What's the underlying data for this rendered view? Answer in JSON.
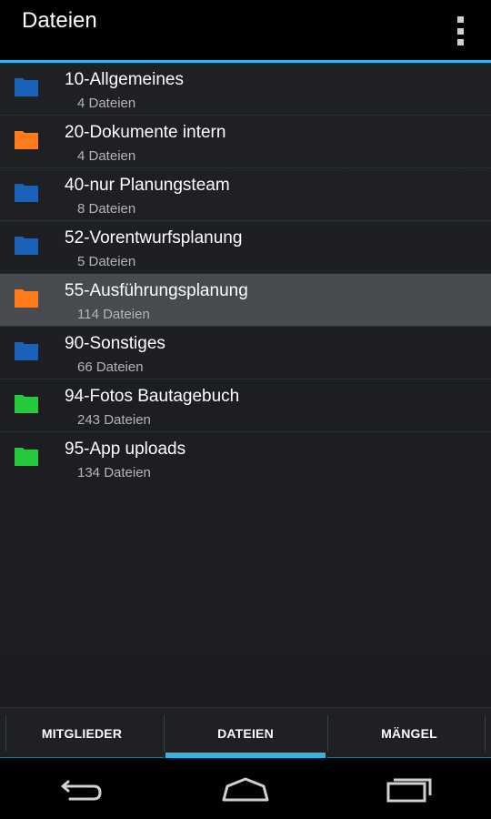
{
  "actionbar": {
    "title": "Dateien",
    "menu_icon": "overflow-menu-icon"
  },
  "colors": {
    "accent": "#33b5e5",
    "folder_blue": "#1a62b8",
    "folder_orange": "#ff7a1a",
    "folder_green": "#25c93c"
  },
  "folders": [
    {
      "name": "10-Allgemeines",
      "count": "4 Dateien",
      "color": "blue",
      "selected": false
    },
    {
      "name": "20-Dokumente intern",
      "count": "4 Dateien",
      "color": "orange",
      "selected": false
    },
    {
      "name": "40-nur Planungsteam",
      "count": "8 Dateien",
      "color": "blue",
      "selected": false
    },
    {
      "name": "52-Vorentwurfsplanung",
      "count": "5 Dateien",
      "color": "blue",
      "selected": false
    },
    {
      "name": "55-Ausführungsplanung",
      "count": "114 Dateien",
      "color": "orange",
      "selected": true
    },
    {
      "name": "90-Sonstiges",
      "count": "66 Dateien",
      "color": "blue",
      "selected": false
    },
    {
      "name": "94-Fotos Bautagebuch",
      "count": "243 Dateien",
      "color": "green",
      "selected": false
    },
    {
      "name": "95-App uploads",
      "count": "134 Dateien",
      "color": "green",
      "selected": false
    }
  ],
  "tabs": [
    {
      "label": "MITGLIEDER",
      "active": false
    },
    {
      "label": "DATEIEN",
      "active": true
    },
    {
      "label": "MÄNGEL",
      "active": false
    }
  ],
  "navbar": {
    "icons": [
      "back-icon",
      "home-icon",
      "recent-apps-icon"
    ]
  }
}
